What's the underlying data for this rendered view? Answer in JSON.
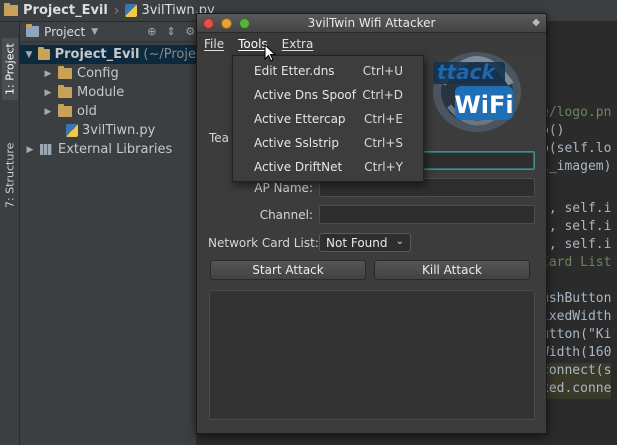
{
  "ide": {
    "breadcrumb_project": "Project_Evil",
    "breadcrumb_file": "3vilTiwn.py",
    "side_tabs": [
      "1: Project",
      "7: Structure"
    ],
    "panel_title": "Project",
    "tree": [
      {
        "label": "Project_Evil",
        "suffix": "(~/Proje",
        "type": "folder",
        "expanded": true
      },
      {
        "label": "Config",
        "type": "folder"
      },
      {
        "label": "Module",
        "type": "folder"
      },
      {
        "label": "old",
        "type": "folder"
      },
      {
        "label": "3vilTiwn.py",
        "type": "python-file"
      },
      {
        "label": "External Libraries",
        "type": "library"
      }
    ],
    "code_fragments": [
      "e/logo.pn",
      "p()",
      "p(self.lo",
      "l_imagem)",
      "', self.i",
      "', self.i",
      "', self.i",
      "Card List",
      "ushButton",
      "ixedWidth",
      "utton(\"Ki",
      "Width(160",
      "connect(s",
      "xed.conne"
    ]
  },
  "window": {
    "title": "3vilTwin Wifi Attacker",
    "menus": [
      "File",
      "Tools",
      "Extra"
    ],
    "logo_text_top": "ttack",
    "logo_text_bottom": "WiFi",
    "form": {
      "partial_label": "Tea",
      "ap_name_label": "AP Name:",
      "channel_label": "Channel:",
      "network_card_label": "Network Card List:",
      "network_card_value": "Not Found"
    },
    "buttons": {
      "start": "Start Attack",
      "kill": "Kill Attack"
    }
  },
  "tools_menu": {
    "items": [
      {
        "label": "Edit Etter.dns",
        "shortcut": "Ctrl+U"
      },
      {
        "label": "Active Dns Spoof",
        "shortcut": "Ctrl+D"
      },
      {
        "label": "Active Ettercap",
        "shortcut": "Ctrl+E"
      },
      {
        "label": "Active Sslstrip",
        "shortcut": "Ctrl+S"
      },
      {
        "label": "Active DriftNet",
        "shortcut": "Ctrl+Y"
      }
    ]
  },
  "colors": {
    "ide_panel": "#3c3f41",
    "editor_bg": "#2b2b2b",
    "window_bg": "#3c3c3c",
    "focus_accent": "#3f8f8c"
  }
}
